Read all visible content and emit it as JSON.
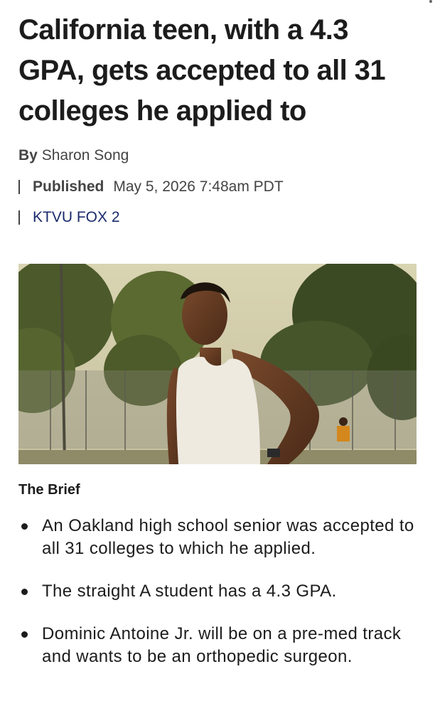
{
  "article": {
    "headline": "California teen, with a 4.3 GPA, gets accepted to all 31 colleges he applied to",
    "byline": {
      "prefix": "By",
      "author": "Sharon Song"
    },
    "published": {
      "label": "Published",
      "date": "May 5, 2026 7:48am PDT"
    },
    "source": "KTVU FOX 2",
    "brief": {
      "title": "The Brief",
      "items": [
        "An Oakland high school senior was accepted to all 31 colleges to which he applied.",
        "The straight A student has a 4.3 GPA.",
        "Dominic Antoine Jr. will be on a pre-med track and wants to be an orthopedic surgeon."
      ]
    }
  },
  "colors": {
    "text": "#1c1c1c",
    "meta": "#444444",
    "link": "#1a2a6c"
  }
}
